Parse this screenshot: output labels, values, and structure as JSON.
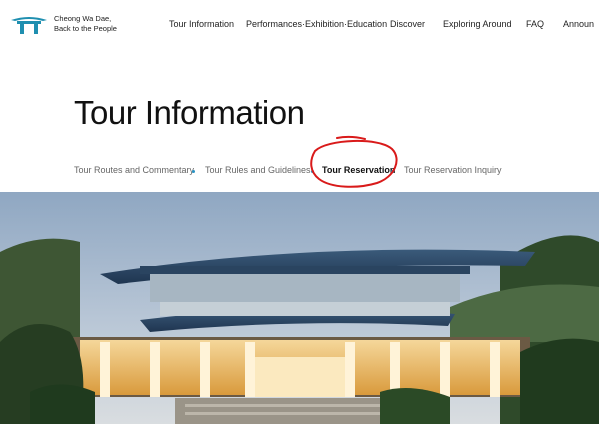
{
  "brand": {
    "line1": "Cheong Wa Dae,",
    "line2": "Back to the People",
    "logo_icon": "gate-roof-icon"
  },
  "nav": {
    "items": [
      "Tour Information",
      "Performances·Exhibition·Education",
      "Discover",
      "Exploring Around",
      "FAQ",
      "Announ"
    ]
  },
  "page": {
    "title": "Tour Information"
  },
  "tabs": {
    "items": [
      "Tour Routes and Commentary",
      "Tour Rules and Guidelines",
      "Tour Reservation",
      "Tour Reservation Inquiry"
    ],
    "active_index": 2
  },
  "colors": {
    "accent": "#2a93c4",
    "annotation": "#d91a1a",
    "logo_teal": "#1f8fb0"
  }
}
